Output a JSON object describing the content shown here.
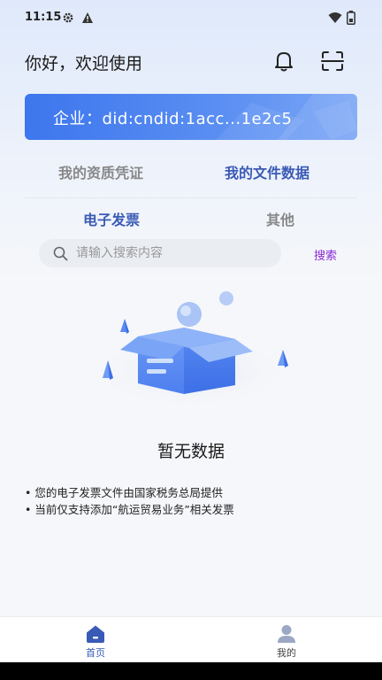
{
  "status_bar": {
    "time": "11:15",
    "icons": [
      "gear-icon",
      "warning-icon",
      "wifi-icon",
      "battery-icon"
    ]
  },
  "header": {
    "greeting": "你好，欢迎使用",
    "icons": [
      "bell-icon",
      "scan-icon"
    ]
  },
  "company_card": {
    "text": "企业：did:cndid:1acc...1e2c5"
  },
  "main_tabs": [
    {
      "label": "我的资质凭证",
      "active": false
    },
    {
      "label": "我的文件数据",
      "active": true
    }
  ],
  "sub_tabs": [
    {
      "label": "电子发票",
      "active": true
    },
    {
      "label": "其他",
      "active": false
    }
  ],
  "search": {
    "placeholder": "请输入搜索内容",
    "value": "",
    "button_label": "搜索"
  },
  "empty_state": {
    "text": "暂无数据"
  },
  "notes": [
    "• 您的电子发票文件由国家税务总局提供",
    "• 当前仅支持添加“航运贸易业务”相关发票"
  ],
  "bottom_nav": [
    {
      "label": "首页",
      "icon": "home-icon",
      "active": true
    },
    {
      "label": "我的",
      "icon": "user-icon",
      "active": false
    }
  ],
  "colors": {
    "accent": "#3a5bb5",
    "card_blue": "#4a80f0",
    "search_button": "#8a2bd6"
  }
}
